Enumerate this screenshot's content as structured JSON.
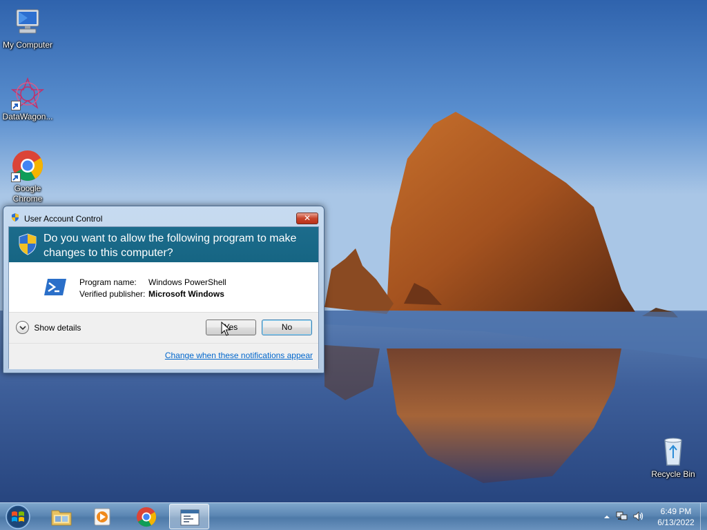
{
  "desktop": {
    "icons": [
      {
        "label": "My Computer",
        "icon": "computer-icon"
      },
      {
        "label": "DataWagon...",
        "icon": "datawagon-icon"
      },
      {
        "label": "Google Chrome",
        "icon": "chrome-icon"
      },
      {
        "label": "Recycle Bin",
        "icon": "recycle-bin-icon"
      }
    ]
  },
  "uac_dialog": {
    "title": "User Account Control",
    "close_glyph": "✕",
    "question": "Do you want to allow the following program to make changes to this computer?",
    "program_name_label": "Program name:",
    "program_name": "Windows PowerShell",
    "publisher_label": "Verified publisher:",
    "publisher": "Microsoft Windows",
    "show_details_label": "Show details",
    "yes_label": "Yes",
    "no_label": "No",
    "change_link": "Change when these notifications appear",
    "header_color": "#1a6a8a"
  },
  "taskbar": {
    "pinned": [
      {
        "name": "windows-explorer",
        "icon": "folder-icon"
      },
      {
        "name": "media-player",
        "icon": "media-player-icon"
      },
      {
        "name": "google-chrome",
        "icon": "chrome-icon"
      },
      {
        "name": "uac-window",
        "icon": "window-icon",
        "active": true
      }
    ],
    "clock_time": "6:49 PM",
    "clock_date": "6/13/2022"
  }
}
